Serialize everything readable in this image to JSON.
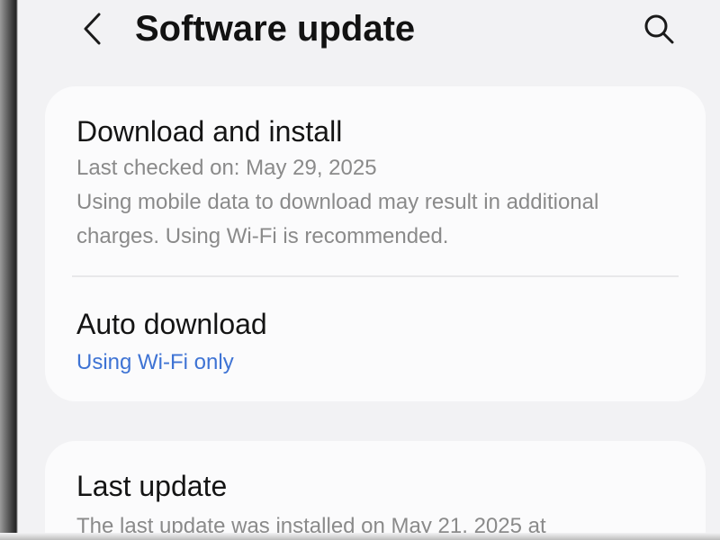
{
  "header": {
    "title": "Software update",
    "back_icon": "chevron-left-icon",
    "search_icon": "search-icon"
  },
  "download_install": {
    "title": "Download and install",
    "last_checked": "Last checked on: May 29, 2025",
    "note_line1": "Using mobile data to download may result in additional",
    "note_line2": "charges. Using Wi-Fi is recommended."
  },
  "auto_download": {
    "title": "Auto download",
    "value": "Using Wi-Fi only"
  },
  "last_update": {
    "title": "Last update",
    "detail": "The last update was installed on May 21, 2025 at"
  },
  "colors": {
    "background": "#f2f2f4",
    "card": "#fbfbfc",
    "accent": "#3e73d4",
    "secondary_text": "#8a8a8a"
  }
}
